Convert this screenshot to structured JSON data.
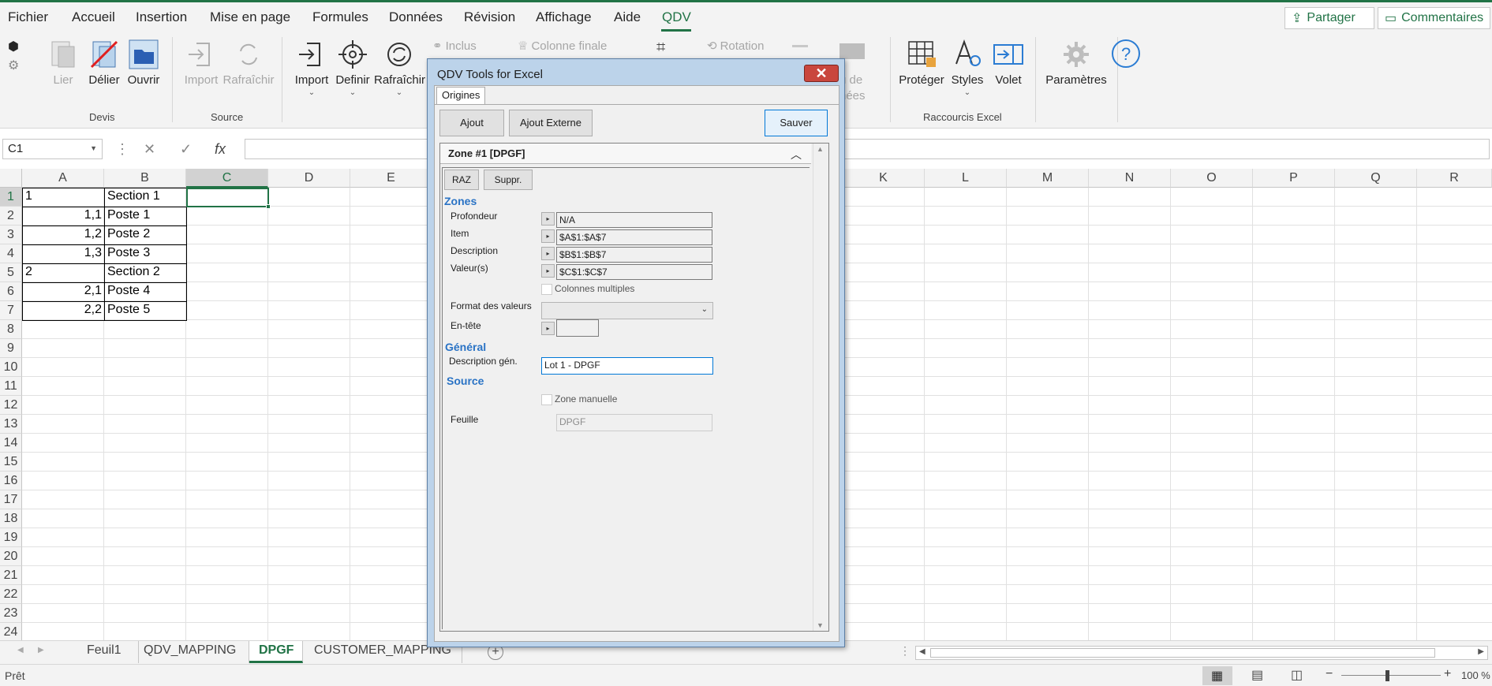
{
  "menu": {
    "items": [
      "Fichier",
      "Accueil",
      "Insertion",
      "Mise en page",
      "Formules",
      "Données",
      "Révision",
      "Affichage",
      "Aide",
      "QDV"
    ],
    "active": "QDV",
    "share": "Partager",
    "comments": "Commentaires"
  },
  "ribbon": {
    "devis": {
      "label": "Devis",
      "lier": "Lier",
      "delier": "Délier",
      "ouvrir": "Ouvrir"
    },
    "source": {
      "label": "Source",
      "import": "Import",
      "rafraichir": "Rafraîchir"
    },
    "qdv": {
      "import": "Import",
      "definir": "Definir",
      "rafraichir": "Rafraîchir",
      "inclus": "Inclus",
      "colonne_finale": "Colonne finale",
      "rotation": "Rotation",
      "partial1": "u de",
      "partial2": "nées"
    },
    "raccourcis": {
      "label": "Raccourcis Excel",
      "proteger": "Protéger",
      "styles": "Styles",
      "volet": "Volet"
    },
    "parametres": "Paramètres",
    "accent_color": "#217346"
  },
  "formula_bar": {
    "name_box": "C1",
    "value": ""
  },
  "grid": {
    "columns": [
      "A",
      "B",
      "C",
      "D",
      "E",
      "K",
      "L",
      "M",
      "N",
      "O",
      "P",
      "Q",
      "R"
    ],
    "rows": [
      "1",
      "2",
      "3",
      "4",
      "5",
      "6",
      "7",
      "8",
      "9",
      "10",
      "11",
      "12",
      "13",
      "14",
      "15",
      "16",
      "17",
      "18",
      "19",
      "20",
      "21",
      "22",
      "23",
      "24"
    ],
    "selected_column": "C",
    "selected_row": "1",
    "data": [
      {
        "a": "1",
        "b": "Section 1"
      },
      {
        "a": "1,1",
        "b": "Poste 1"
      },
      {
        "a": "1,2",
        "b": "Poste 2"
      },
      {
        "a": "1,3",
        "b": "Poste 3"
      },
      {
        "a": "2",
        "b": "Section 2"
      },
      {
        "a": "2,1",
        "b": "Poste 4"
      },
      {
        "a": "2,2",
        "b": "Poste 5"
      }
    ]
  },
  "sheets": [
    "Feuil1",
    "QDV_MAPPING",
    "DPGF",
    "CUSTOMER_MAPPING"
  ],
  "active_sheet": "DPGF",
  "status": {
    "text": "Prêt",
    "zoom": "100 %"
  },
  "dialog": {
    "title": "QDV Tools for Excel",
    "tab": "Origines",
    "ajout": "Ajout",
    "ajout_externe": "Ajout Externe",
    "sauver": "Sauver",
    "zone_header": "Zone #1 [DPGF]",
    "raz": "RAZ",
    "suppr": "Suppr.",
    "zones_label": "Zones",
    "profondeur_label": "Profondeur",
    "profondeur_value": "N/A",
    "item_label": "Item",
    "item_value": "$A$1:$A$7",
    "description_label": "Description",
    "description_value": "$B$1:$B$7",
    "valeurs_label": "Valeur(s)",
    "valeurs_value": "$C$1:$C$7",
    "colonnes_multiples": "Colonnes multiples",
    "format_label": "Format des valeurs",
    "entete_label": "En-tête",
    "general_label": "Général",
    "desc_gen_label": "Description gén.",
    "desc_gen_value": "Lot 1 - DPGF",
    "source_label": "Source",
    "zone_manuelle": "Zone manuelle",
    "feuille_label": "Feuille",
    "feuille_value": "DPGF"
  }
}
